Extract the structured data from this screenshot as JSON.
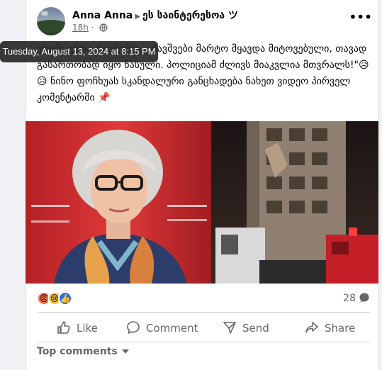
{
  "post": {
    "author": "Anna Anna",
    "group": "ეს საინტერესოა ツ",
    "time": "18h",
    "timestamp_tooltip": "Tuesday, August 13, 2024 at 8:15 PM",
    "text": "ერამე უნდა დავწერო… ბავშვები მარტო მყავდა მიტოვებული, თავად გასართობად იყო წასული. პოლიციამ ძლივს მიაკვლია მთვრალს!\"😥😥 ნინო ფოჩხუას სკანდალური განცხადება ნახეთ ვიდეო პირველ კომენტარში 📌"
  },
  "reactions": {
    "icons": [
      "angry",
      "sad",
      "like"
    ],
    "comment_count": "28"
  },
  "actions": {
    "like": "Like",
    "comment": "Comment",
    "send": "Send",
    "share": "Share"
  },
  "comments": {
    "sort_label": "Top comments"
  },
  "icons": {
    "more": "more-options-icon",
    "audience": "globe-icon",
    "comment_count": "speech-bubble-icon"
  },
  "colors": {
    "accent": "#1b74e4",
    "secondary_text": "#65676b",
    "divider": "#ced0d4"
  }
}
